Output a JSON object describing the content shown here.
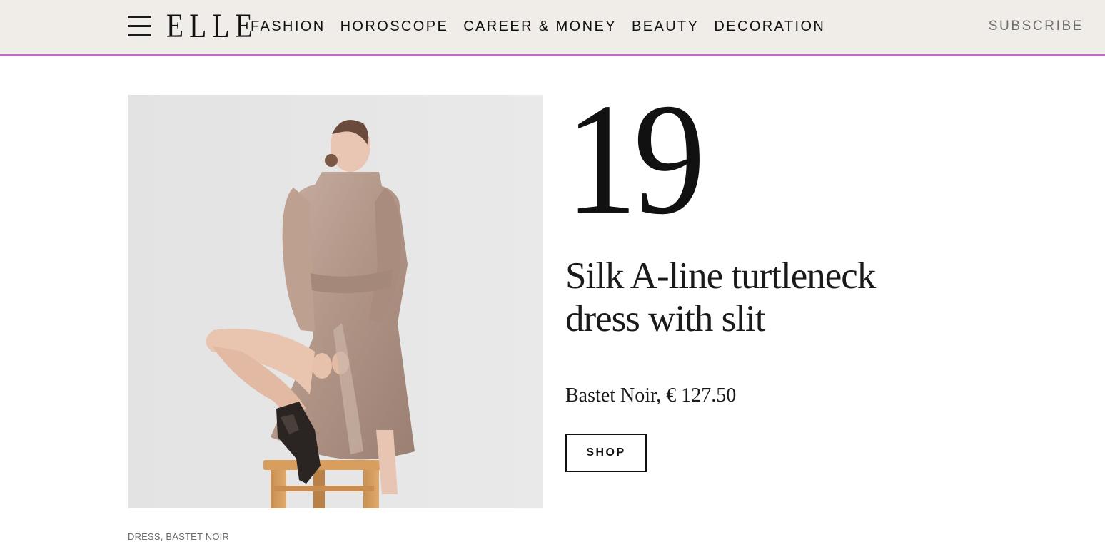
{
  "header": {
    "logo": "ELLE",
    "nav": [
      "FASHION",
      "HOROSCOPE",
      "CAREER & MONEY",
      "BEAUTY",
      "DECORATION"
    ],
    "subscribe_label": "SUBSCRIBE"
  },
  "product": {
    "number": "19",
    "title": "Silk A-line turtleneck dress with slit",
    "price_line": "Bastet Noir, € 127.50",
    "shop_label": "SHOP",
    "tags": "DRESS, BASTET NOIR",
    "image_alt": "Model in beige silk turtleneck dress sitting on a wooden stool"
  },
  "colors": {
    "header_bg": "#f0ede9",
    "header_border": "#b86fc3",
    "dress": "#b59c8e",
    "photo_bg": "#e6e6e6"
  }
}
